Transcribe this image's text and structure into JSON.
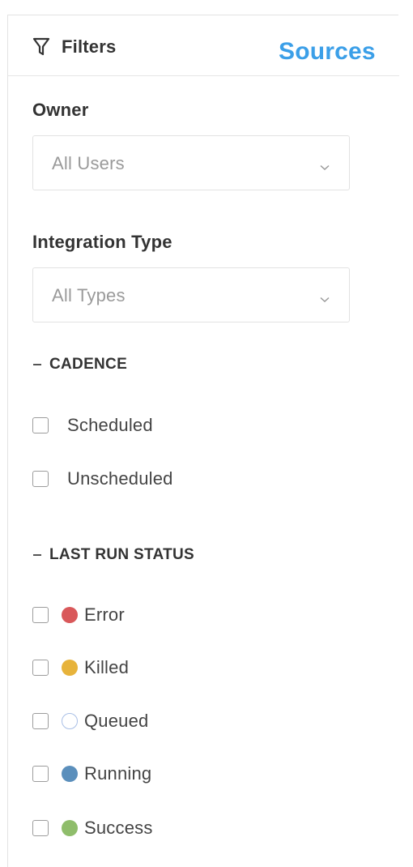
{
  "header": {
    "filters_label": "Filters",
    "sources_label": "Sources",
    "filter_icon": "filter-funnel-icon",
    "accent_color": "#3b9fe8"
  },
  "owner": {
    "label": "Owner",
    "selected": "All Users",
    "chevron_icon": "chevron-down-icon"
  },
  "integration_type": {
    "label": "Integration Type",
    "selected": "All Types",
    "chevron_icon": "chevron-down-icon"
  },
  "cadence": {
    "title": "CADENCE",
    "collapse_symbol": "–",
    "options": [
      {
        "label": "Scheduled",
        "checked": false
      },
      {
        "label": "Unscheduled",
        "checked": false
      }
    ]
  },
  "last_run_status": {
    "title": "LAST RUN STATUS",
    "collapse_symbol": "–",
    "options": [
      {
        "label": "Error",
        "checked": false,
        "color": "#d9585a",
        "dot_style": "filled"
      },
      {
        "label": "Killed",
        "checked": false,
        "color": "#e7b33b",
        "dot_style": "filled"
      },
      {
        "label": "Queued",
        "checked": false,
        "color": "#a9bfe6",
        "dot_style": "outline"
      },
      {
        "label": "Running",
        "checked": false,
        "color": "#5b8fbc",
        "dot_style": "filled"
      },
      {
        "label": "Success",
        "checked": false,
        "color": "#8fbd6b",
        "dot_style": "filled"
      }
    ]
  }
}
